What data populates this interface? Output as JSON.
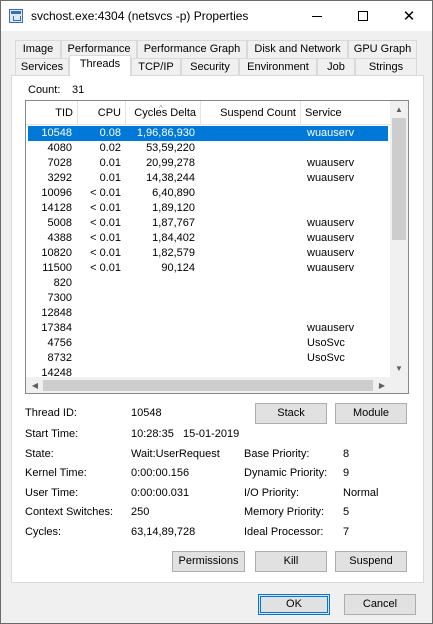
{
  "window": {
    "title": "svchost.exe:4304 (netsvcs -p) Properties"
  },
  "tabs_row1": [
    {
      "label": "Image"
    },
    {
      "label": "Performance"
    },
    {
      "label": "Performance Graph"
    },
    {
      "label": "Disk and Network"
    },
    {
      "label": "GPU Graph"
    }
  ],
  "tabs_row2": [
    {
      "label": "Services"
    },
    {
      "label": "Threads",
      "active": true
    },
    {
      "label": "TCP/IP"
    },
    {
      "label": "Security"
    },
    {
      "label": "Environment"
    },
    {
      "label": "Job"
    },
    {
      "label": "Strings"
    }
  ],
  "count": {
    "label": "Count:",
    "value": "31"
  },
  "thread_list": {
    "columns": [
      "TID",
      "CPU",
      "Cycles Delta",
      "Suspend Count",
      "Service"
    ],
    "sorted_column": "Cycles Delta",
    "rows": [
      {
        "tid": "10548",
        "cpu": "0.08",
        "cycles": "1,96,86,930",
        "suspend": "",
        "service": "wuauserv",
        "selected": true
      },
      {
        "tid": "4080",
        "cpu": "0.02",
        "cycles": "53,59,220",
        "suspend": "",
        "service": ""
      },
      {
        "tid": "7028",
        "cpu": "0.01",
        "cycles": "20,99,278",
        "suspend": "",
        "service": "wuauserv"
      },
      {
        "tid": "3292",
        "cpu": "0.01",
        "cycles": "14,38,244",
        "suspend": "",
        "service": "wuauserv"
      },
      {
        "tid": "10096",
        "cpu": "< 0.01",
        "cycles": "6,40,890",
        "suspend": "",
        "service": ""
      },
      {
        "tid": "14128",
        "cpu": "< 0.01",
        "cycles": "1,89,120",
        "suspend": "",
        "service": ""
      },
      {
        "tid": "5008",
        "cpu": "< 0.01",
        "cycles": "1,87,767",
        "suspend": "",
        "service": "wuauserv"
      },
      {
        "tid": "4388",
        "cpu": "< 0.01",
        "cycles": "1,84,402",
        "suspend": "",
        "service": "wuauserv"
      },
      {
        "tid": "10820",
        "cpu": "< 0.01",
        "cycles": "1,82,579",
        "suspend": "",
        "service": "wuauserv"
      },
      {
        "tid": "11500",
        "cpu": "< 0.01",
        "cycles": "90,124",
        "suspend": "",
        "service": "wuauserv"
      },
      {
        "tid": "820",
        "cpu": "",
        "cycles": "",
        "suspend": "",
        "service": ""
      },
      {
        "tid": "7300",
        "cpu": "",
        "cycles": "",
        "suspend": "",
        "service": ""
      },
      {
        "tid": "12848",
        "cpu": "",
        "cycles": "",
        "suspend": "",
        "service": ""
      },
      {
        "tid": "17384",
        "cpu": "",
        "cycles": "",
        "suspend": "",
        "service": "wuauserv"
      },
      {
        "tid": "4756",
        "cpu": "",
        "cycles": "",
        "suspend": "",
        "service": "UsoSvc"
      },
      {
        "tid": "8732",
        "cpu": "",
        "cycles": "",
        "suspend": "",
        "service": "UsoSvc"
      },
      {
        "tid": "14248",
        "cpu": "",
        "cycles": "",
        "suspend": "",
        "service": ""
      }
    ]
  },
  "details": {
    "thread_id_label": "Thread ID:",
    "thread_id": "10548",
    "start_time_label": "Start Time:",
    "start_time": "10:28:35   15-01-2019",
    "state_label": "State:",
    "state": "Wait:UserRequest",
    "kernel_time_label": "Kernel Time:",
    "kernel_time": "0:00:00.156",
    "user_time_label": "User Time:",
    "user_time": "0:00:00.031",
    "context_switches_label": "Context Switches:",
    "context_switches": "250",
    "cycles_label": "Cycles:",
    "cycles": "63,14,89,728",
    "base_priority_label": "Base Priority:",
    "base_priority": "8",
    "dynamic_priority_label": "Dynamic Priority:",
    "dynamic_priority": "9",
    "io_priority_label": "I/O Priority:",
    "io_priority": "Normal",
    "memory_priority_label": "Memory Priority:",
    "memory_priority": "5",
    "ideal_processor_label": "Ideal Processor:",
    "ideal_processor": "7"
  },
  "buttons": {
    "stack": "Stack",
    "module": "Module",
    "permissions": "Permissions",
    "kill": "Kill",
    "suspend": "Suspend",
    "ok": "OK",
    "cancel": "Cancel"
  },
  "icons": {
    "app": "process-properties-icon",
    "minimize": "minimize-icon",
    "maximize": "maximize-icon",
    "close": "close-icon"
  },
  "colors": {
    "selection": "#0078d7",
    "default_button_border": "#0078d7"
  }
}
